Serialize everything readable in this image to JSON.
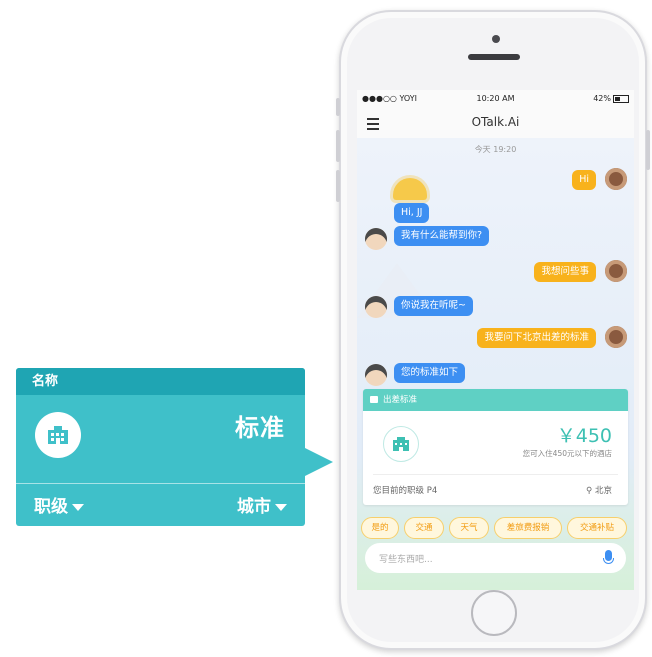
{
  "callout": {
    "header": "名称",
    "value": "标准",
    "left_dropdown": "职级",
    "right_dropdown": "城市",
    "icon": "building-icon"
  },
  "status_bar": {
    "carrier": "●●●○○ YOYI",
    "time": "10:20 AM",
    "battery": "42%"
  },
  "app": {
    "title": "OTalk.Ai"
  },
  "chat": {
    "timestamp": "今天 19:20",
    "messages": [
      {
        "from": "user",
        "text": "Hi"
      },
      {
        "from": "bot",
        "text": "Hi, JJ"
      },
      {
        "from": "bot",
        "text": "我有什么能帮到你?"
      },
      {
        "from": "user",
        "text": "我想问些事"
      },
      {
        "from": "bot",
        "text": "你说我在听呢~"
      },
      {
        "from": "user",
        "text": "我要问下北京出差的标准"
      },
      {
        "from": "bot",
        "text": "您的标准如下"
      }
    ]
  },
  "standard_card": {
    "title": "出差标准",
    "price": "￥450",
    "description": "您可入住450元以下的酒店",
    "level": "您目前的职级 P4",
    "city": "北京"
  },
  "quick_replies": [
    "是的",
    "交通",
    "天气",
    "差旅费报销",
    "交通补贴"
  ],
  "input": {
    "placeholder": "写些东西吧..."
  },
  "colors": {
    "callout_teal": "#3fc0c9",
    "callout_header": "#1fa5b3",
    "bot_bubble": "#3d8ff2",
    "user_bubble": "#f8b21c",
    "card_header": "#5fd0c4"
  }
}
